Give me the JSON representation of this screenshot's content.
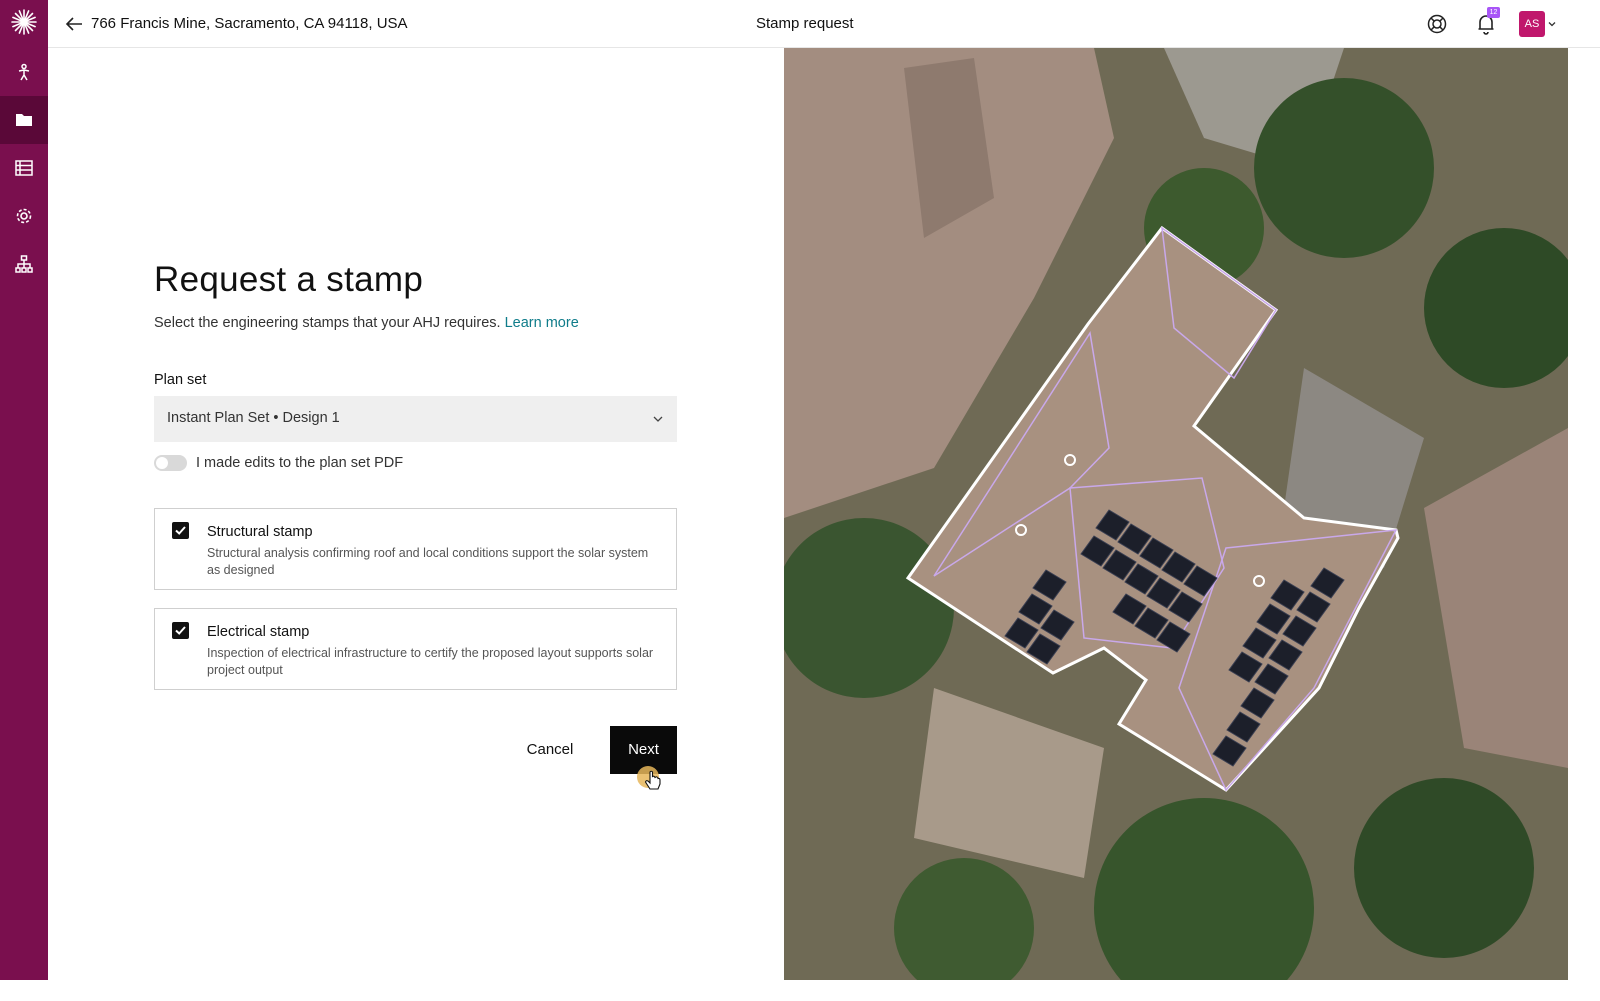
{
  "header": {
    "address": "766 Francis Mine, Sacramento, CA 94118, USA",
    "page_title": "Stamp request",
    "notification_count": "12",
    "avatar_initials": "AS"
  },
  "sidebar": {
    "items": [
      {
        "icon": "person-icon"
      },
      {
        "icon": "folder-icon",
        "active": true
      },
      {
        "icon": "table-icon"
      },
      {
        "icon": "gear-icon"
      },
      {
        "icon": "org-chart-icon"
      }
    ]
  },
  "form": {
    "title": "Request a stamp",
    "subtitle": "Select the engineering stamps that your AHJ requires.",
    "learn_more": "Learn more",
    "plan_set_label": "Plan set",
    "plan_set_value": "Instant Plan Set • Design 1",
    "toggle_label": "I made edits to the plan set PDF",
    "toggle_on": false,
    "stamps": [
      {
        "title": "Structural stamp",
        "description": "Structural analysis confirming roof and local conditions support the solar system as designed",
        "checked": true
      },
      {
        "title": "Electrical stamp",
        "description": "Inspection of electrical infrastructure to certify the proposed layout supports solar project output",
        "checked": true
      }
    ],
    "cancel_label": "Cancel",
    "next_label": "Next"
  },
  "colors": {
    "sidebar": "#7a0f4e",
    "accent_link": "#0f7c8a",
    "primary_button": "#0a0a0a",
    "badge": "#a855f7",
    "avatar": "#c0176c"
  }
}
